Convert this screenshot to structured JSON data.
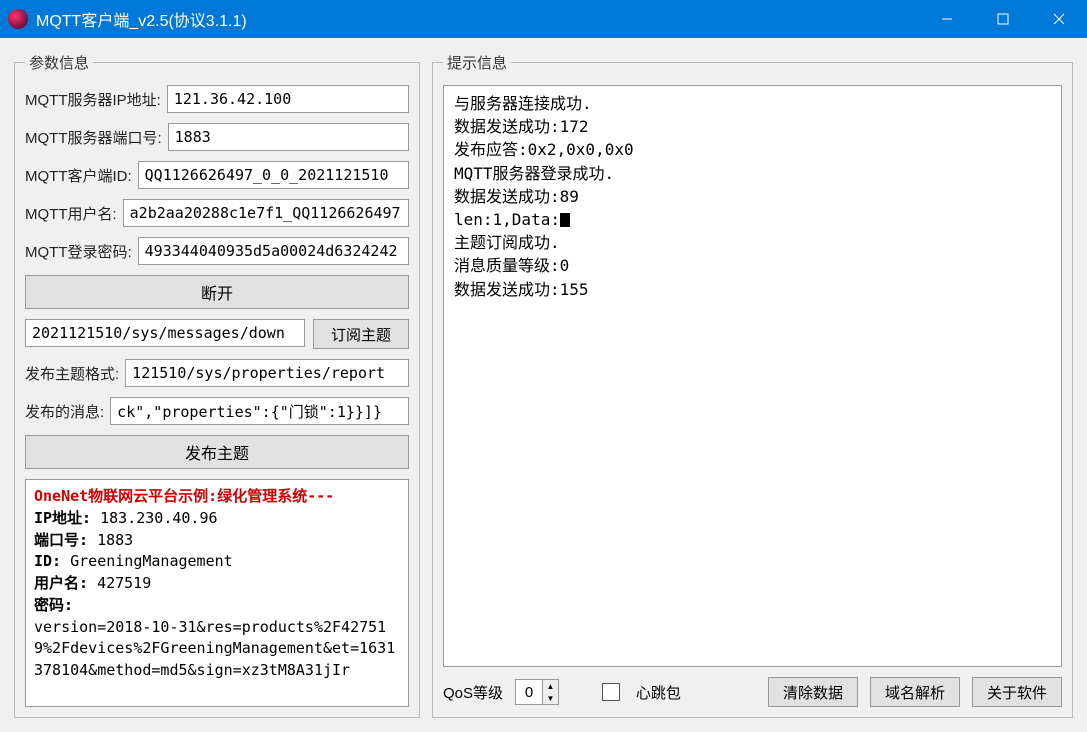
{
  "window": {
    "title": "MQTT客户端_v2.5(协议3.1.1)"
  },
  "params": {
    "legend": "参数信息",
    "ip_label": "MQTT服务器IP地址:",
    "ip_value": "121.36.42.100",
    "port_label": "MQTT服务器端口号:",
    "port_value": "1883",
    "clientid_label": "MQTT客户端ID:",
    "clientid_value": "QQ1126626497_0_0_2021121510",
    "user_label": "MQTT用户名:",
    "user_value": "a2b2aa20288c1e7f1_QQ1126626497",
    "pwd_label": "MQTT登录密码:",
    "pwd_value": "493344040935d5a00024d6324242",
    "disconnect_btn": "断开",
    "sub_topic_value": "2021121510/sys/messages/down",
    "sub_btn": "订阅主题",
    "pub_topic_label": "发布主题格式:",
    "pub_topic_value": "121510/sys/properties/report",
    "pub_msg_label": "发布的消息:",
    "pub_msg_value": "ck\",\"properties\":{\"门锁\":1}}]}",
    "pub_btn": "发布主题"
  },
  "example": {
    "title": "OneNet物联网云平台示例:绿化管理系统---",
    "ip_label": "IP地址:",
    "ip": "183.230.40.96",
    "port_label": "端口号:",
    "port": "1883",
    "id_label": "ID:",
    "id": "GreeningManagement",
    "user_label": "用户名:",
    "user": "427519",
    "pwd_label": "密码:",
    "pwd": "version=2018-10-31&res=products%2F427519%2Fdevices%2FGreeningManagement&et=1631378104&method=md5&sign=xz3tM8A31jIr"
  },
  "hint": {
    "legend": "提示信息",
    "lines": {
      "l1": "与服务器连接成功.",
      "l2": "数据发送成功:172",
      "l3": "发布应答:0x2,0x0,0x0",
      "l4": "MQTT服务器登录成功.",
      "l5": "数据发送成功:89",
      "l6a": "len:1,Data:",
      "l7": "主题订阅成功.",
      "l8": "消息质量等级:0",
      "l9": "数据发送成功:155"
    }
  },
  "bottom": {
    "qos_label": "QoS等级",
    "qos_value": "0",
    "heartbeat_label": "心跳包",
    "clear_btn": "清除数据",
    "dns_btn": "域名解析",
    "about_btn": "关于软件"
  }
}
